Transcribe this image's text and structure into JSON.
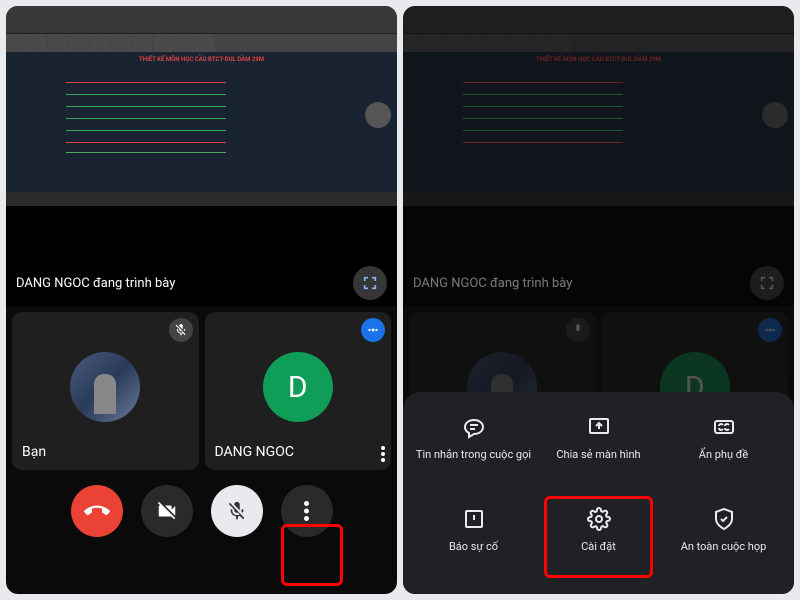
{
  "cad": {
    "title": "THIẾT KẾ MÔN HỌC CẦU BTCT-DUL DẦM 29M"
  },
  "share": {
    "caption": "DANG NGOC đang trình bày"
  },
  "participants": {
    "self": {
      "name": "Bạn"
    },
    "other": {
      "name": "DANG NGOC",
      "initial": "D"
    }
  },
  "sheet": {
    "chat": "Tin nhắn trong cuộc gọi",
    "share_screen": "Chia sẻ màn hình",
    "captions": "Ẩn phụ đề",
    "report": "Báo sự cố",
    "settings": "Cài đặt",
    "safety": "An toàn cuộc họp"
  }
}
